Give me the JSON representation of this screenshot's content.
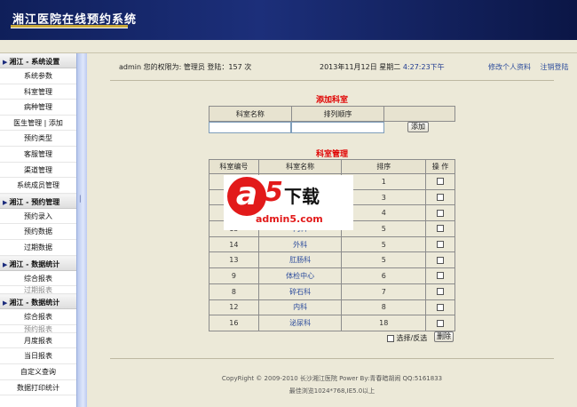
{
  "header": {
    "title": "湘江医院在线预约系统"
  },
  "sidebar": {
    "groups": [
      {
        "label": "湘江 - 系统设置",
        "items": [
          "系统参数",
          "科室管理",
          "病种管理",
          "医生管理 | 添加",
          "预约类型",
          "客服管理",
          "渠道管理",
          "系统成员管理"
        ]
      },
      {
        "label": "湘江 - 预约管理",
        "items": [
          "预约录入",
          "预约数据",
          "过期数据"
        ]
      },
      {
        "label": "湘江 - 数据统计",
        "items": [
          "综合报表",
          "过期报表"
        ]
      },
      {
        "label": "湘江 - 数据统计",
        "items": [
          "综合报表",
          "预约报表",
          "月度报表",
          "当日报表",
          "自定义查询",
          "数据打印统计"
        ]
      }
    ]
  },
  "topbar": {
    "user_info": "admin 您的权限为: 管理员 登陆：157 次",
    "date": "2013年11月12日 星期二",
    "time": "4:27:23下午",
    "link_profile": "修改个人资料",
    "link_logout": "注销登陆"
  },
  "add_section": {
    "title": "添加科室",
    "col_name": "科室名称",
    "col_order": "排列顺序",
    "name_value": "",
    "order_value": "",
    "add_button": "添加"
  },
  "manage_section": {
    "title": "科室管理",
    "columns": [
      "科室编号",
      "科室名称",
      "排序",
      "操 作"
    ],
    "rows": [
      {
        "id": "",
        "name": "",
        "order": "1"
      },
      {
        "id": "",
        "name": "",
        "order": "3"
      },
      {
        "id": "",
        "name": "",
        "order": "4"
      },
      {
        "id": "15",
        "name": "内科",
        "order": "5"
      },
      {
        "id": "14",
        "name": "外科",
        "order": "5"
      },
      {
        "id": "13",
        "name": "肛肠科",
        "order": "5"
      },
      {
        "id": "9",
        "name": "体检中心",
        "order": "6"
      },
      {
        "id": "8",
        "name": "碎石科",
        "order": "7"
      },
      {
        "id": "12",
        "name": "内科",
        "order": "8"
      },
      {
        "id": "16",
        "name": "泌尿科",
        "order": "18"
      }
    ],
    "select_all_label": "选择/反选",
    "delete_button": "删除"
  },
  "footer": {
    "line1": "CopyRight © 2009-2010 长沙湘江医院 Power By:青春暗胡闹 QQ:5161833",
    "line2": "最佳浏览1024*768,IE5.0以上"
  },
  "watermark": {
    "brand_a": "a",
    "brand_5": "5",
    "brand_text": "下载",
    "url": "admin5.com"
  }
}
